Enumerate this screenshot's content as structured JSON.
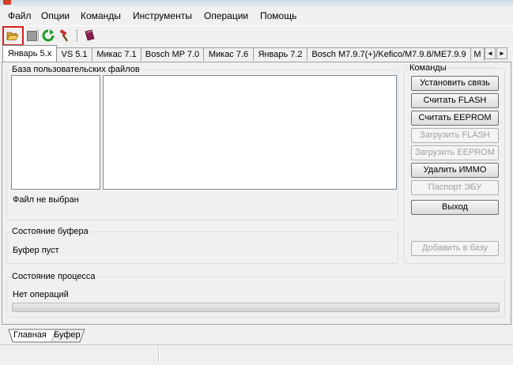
{
  "window": {
    "title": ""
  },
  "menu": [
    "Файл",
    "Опции",
    "Команды",
    "Инструменты",
    "Операции",
    "Помощь"
  ],
  "toolbar": {
    "icons": [
      "open-folder-icon",
      "stop-icon",
      "refresh-icon",
      "hammer-icon",
      "book-icon"
    ]
  },
  "tabs": [
    "Январь 5.x",
    "VS 5.1",
    "Микас 7.1",
    "Bosch MP 7.0",
    "Микас 7.6",
    "Январь 7.2",
    "Bosch M7.9.7(+)/Kefico/M7.9.8/ME7.9.9",
    "M"
  ],
  "tab_scroll": {
    "left": "◄",
    "right": "►"
  },
  "user_files": {
    "title": "База пользовательских файлов",
    "file_status": "Файл не выбран"
  },
  "buffer": {
    "title": "Состояние буфера",
    "status": "Буфер пуст"
  },
  "commands": {
    "title": "Команды",
    "buttons": [
      {
        "label": "Установить связь",
        "enabled": true
      },
      {
        "label": "Считать FLASH",
        "enabled": true
      },
      {
        "label": "Считать EEPROM",
        "enabled": true
      },
      {
        "label": "Загрузить FLASH",
        "enabled": false
      },
      {
        "label": "Загрузить EEPROM",
        "enabled": false
      },
      {
        "label": "Удалить ИММО",
        "enabled": true
      },
      {
        "label": "Паспорт ЭБУ",
        "enabled": false
      },
      {
        "label": "Выход",
        "enabled": true
      }
    ],
    "add_to_db": {
      "label": "Добавить в базу",
      "enabled": false
    }
  },
  "process": {
    "title": "Состояние процесса",
    "status": "Нет операций",
    "progress": 0
  },
  "bottom_tabs": [
    "Главная",
    "Буфер"
  ],
  "colors": {
    "highlight": "#d42020",
    "disabled_text": "#a0a0a0"
  }
}
